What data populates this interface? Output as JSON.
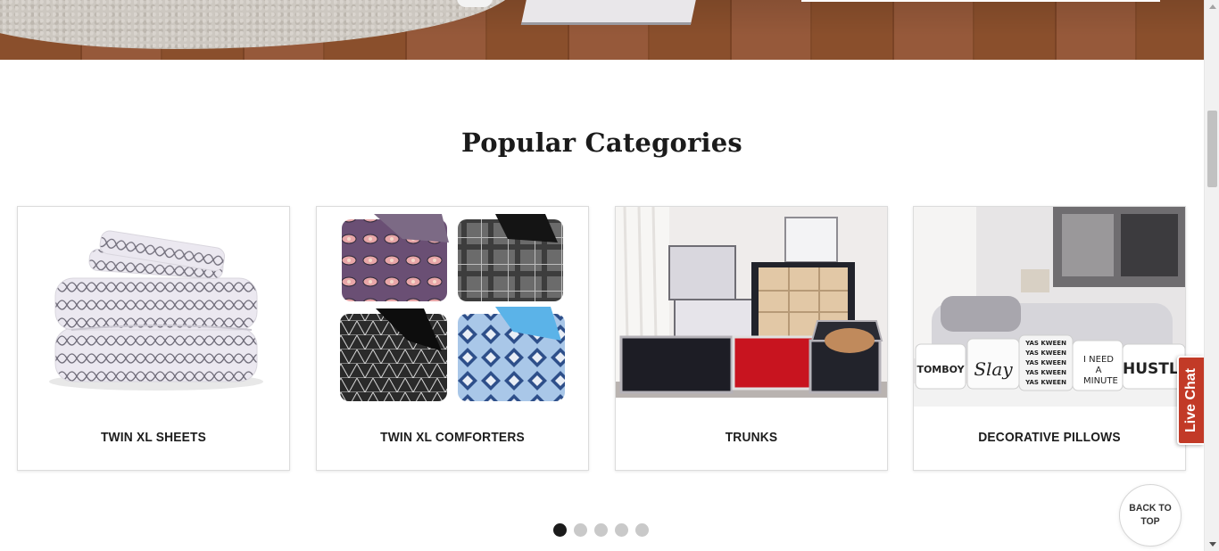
{
  "section": {
    "title": "Popular Categories"
  },
  "categories": [
    {
      "label": "TWIN XL SHEETS"
    },
    {
      "label": "TWIN XL COMFORTERS"
    },
    {
      "label": "TRUNKS"
    },
    {
      "label": "DECORATIVE PILLOWS",
      "pillow_texts": [
        "TOMBOY",
        "Slay",
        "YAS KWEEN",
        "YAS KWEEN",
        "YAS KWEEN",
        "YAS KWEEN",
        "YAS KWEEN",
        "I NEED A MINUTE",
        "HUSTLE"
      ]
    }
  ],
  "carousel": {
    "page_count": 5,
    "active_index": 0
  },
  "back_to_top": {
    "label": "BACK TO TOP"
  },
  "live_chat": {
    "label": "Live Chat"
  },
  "colors": {
    "accent": "#c23a27",
    "title": "#1b1b1b",
    "dot_active": "#1b1b1b",
    "dot_inactive": "#c9c9c9"
  }
}
